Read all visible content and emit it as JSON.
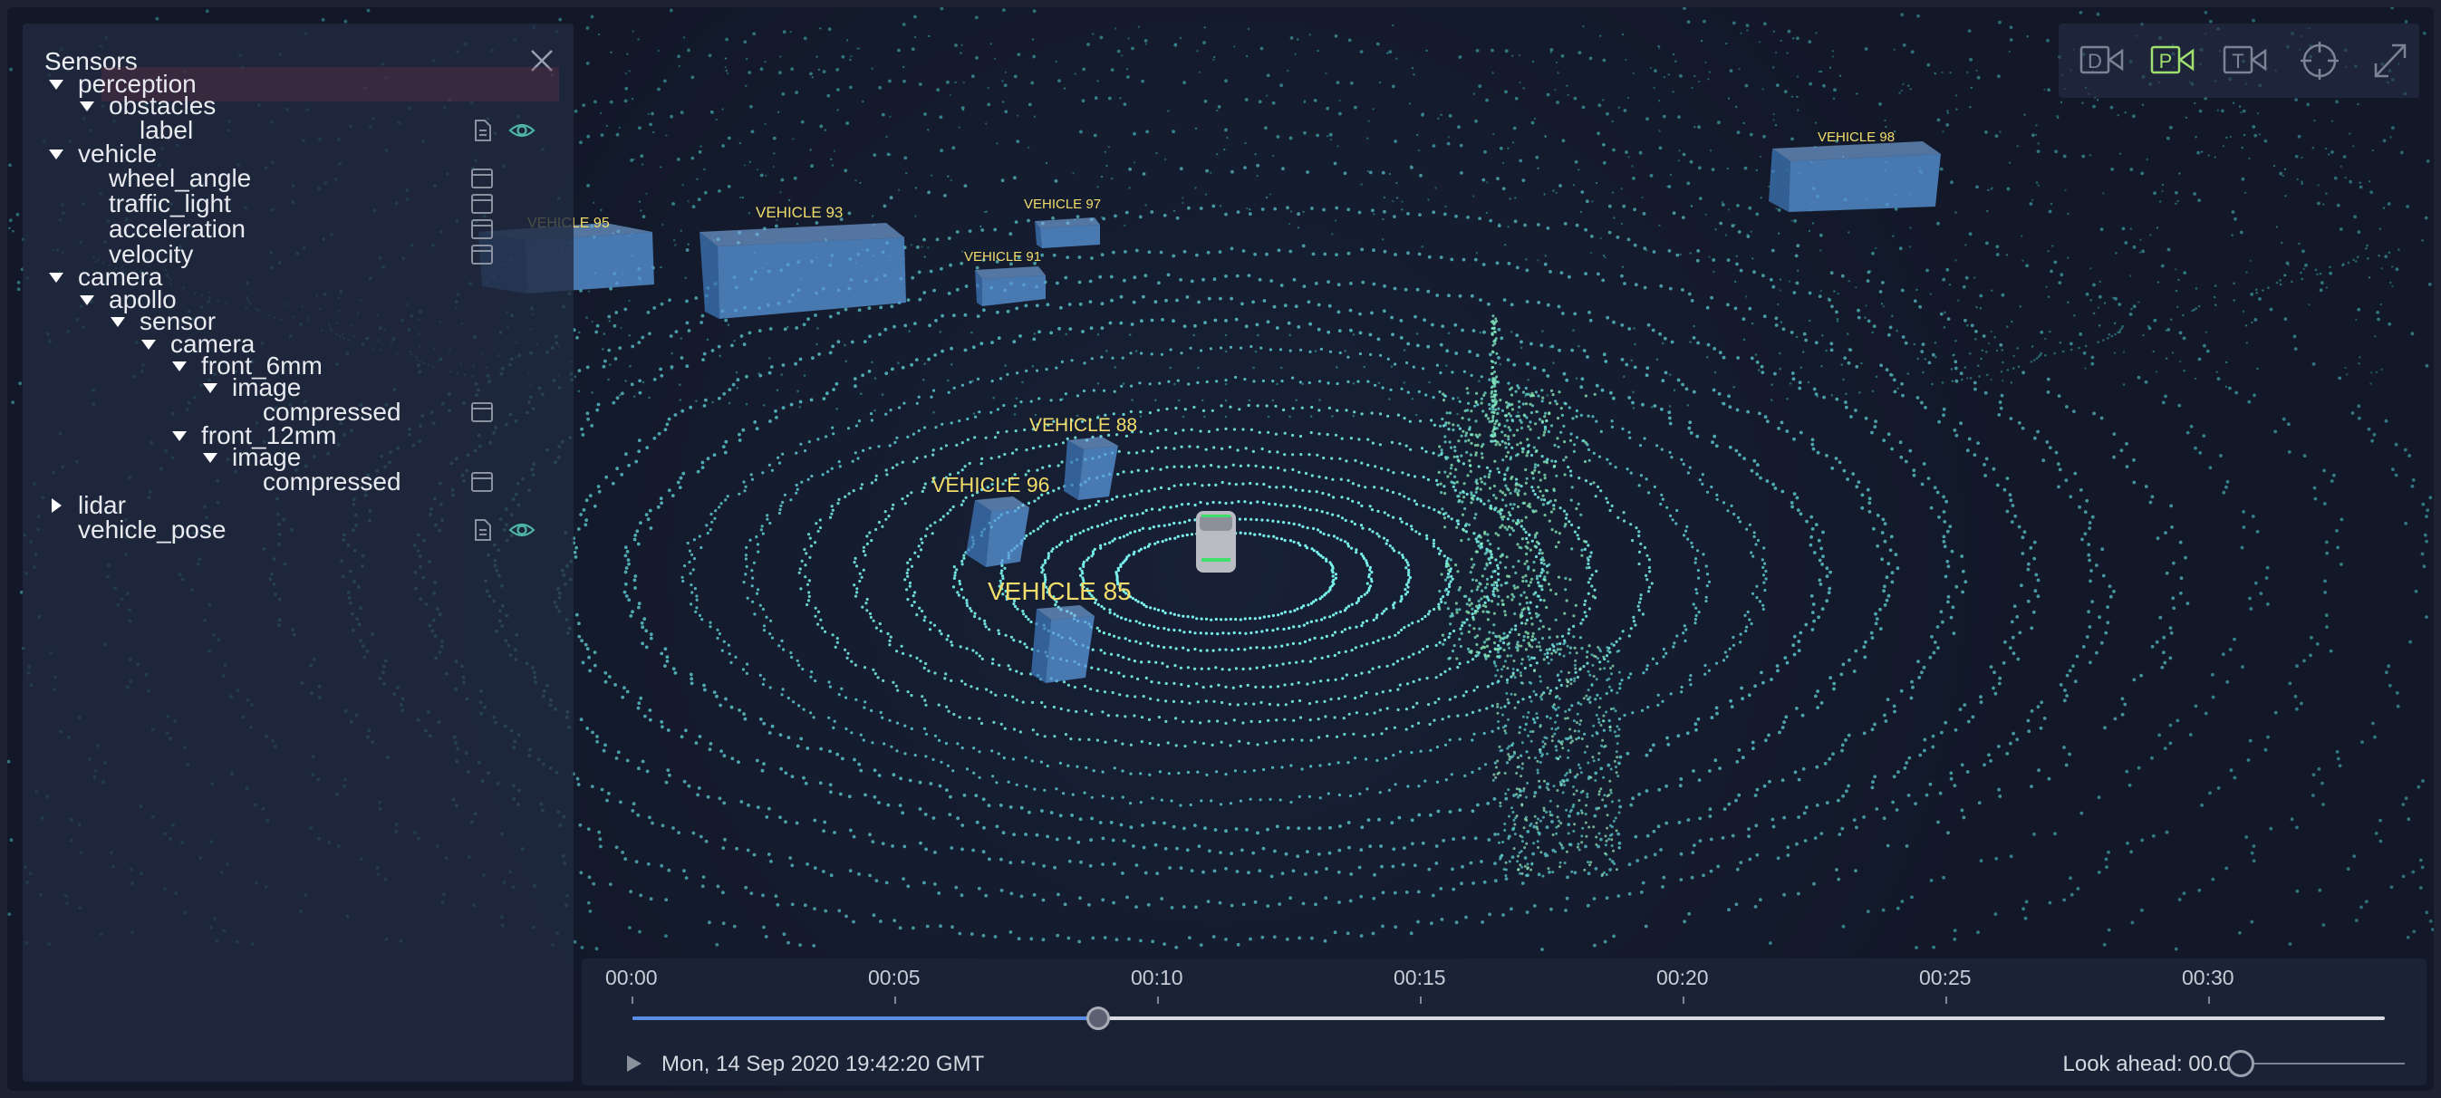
{
  "colors": {
    "accent": "#5a8de6",
    "vehicle_label": "#f2dd6b",
    "point_cloud": "#6ff0e0",
    "box_fill": "#4f8fd0"
  },
  "sensors_panel": {
    "title": "Sensors",
    "tree": [
      {
        "label": "perception",
        "depth": 0,
        "arrow": "down",
        "selected": true
      },
      {
        "label": "obstacles",
        "depth": 1,
        "arrow": "down"
      },
      {
        "label": "label",
        "depth": 2,
        "arrow": "none",
        "icons": [
          "document-icon",
          "eye-icon"
        ]
      },
      {
        "label": "vehicle",
        "depth": 0,
        "arrow": "down"
      },
      {
        "label": "wheel_angle",
        "depth": 1,
        "arrow": "none",
        "icons": [
          "panel-icon"
        ]
      },
      {
        "label": "traffic_light",
        "depth": 1,
        "arrow": "none",
        "icons": [
          "panel-icon"
        ]
      },
      {
        "label": "acceleration",
        "depth": 1,
        "arrow": "none",
        "icons": [
          "panel-icon"
        ]
      },
      {
        "label": "velocity",
        "depth": 1,
        "arrow": "none",
        "icons": [
          "panel-icon"
        ]
      },
      {
        "label": "camera",
        "depth": 0,
        "arrow": "down"
      },
      {
        "label": "apollo",
        "depth": 1,
        "arrow": "down"
      },
      {
        "label": "sensor",
        "depth": 2,
        "arrow": "down"
      },
      {
        "label": "camera",
        "depth": 3,
        "arrow": "down"
      },
      {
        "label": "front_6mm",
        "depth": 4,
        "arrow": "down"
      },
      {
        "label": "image",
        "depth": 5,
        "arrow": "down"
      },
      {
        "label": "compressed",
        "depth": 6,
        "arrow": "none",
        "icons": [
          "panel-icon"
        ]
      },
      {
        "label": "front_12mm",
        "depth": 4,
        "arrow": "down"
      },
      {
        "label": "image",
        "depth": 5,
        "arrow": "down"
      },
      {
        "label": "compressed",
        "depth": 6,
        "arrow": "none",
        "icons": [
          "panel-icon"
        ]
      },
      {
        "label": "lidar",
        "depth": 0,
        "arrow": "right"
      },
      {
        "label": "vehicle_pose",
        "depth": 0,
        "arrow": "none",
        "icons": [
          "document-icon",
          "eye-icon"
        ]
      }
    ]
  },
  "toolbar": {
    "buttons": [
      {
        "letter": "D",
        "name": "driver-camera-button",
        "active": false
      },
      {
        "letter": "P",
        "name": "perspective-camera-button",
        "active": true
      },
      {
        "letter": "T",
        "name": "top-camera-button",
        "active": false
      }
    ]
  },
  "scene": {
    "vehicles": [
      {
        "label": "VEHICLE 95"
      },
      {
        "label": "VEHICLE 93"
      },
      {
        "label": "VEHICLE 97"
      },
      {
        "label": "VEHICLE 91"
      },
      {
        "label": "VEHICLE 98"
      },
      {
        "label": "VEHICLE 88"
      },
      {
        "label": "VEHICLE 96"
      },
      {
        "label": "VEHICLE 85"
      }
    ]
  },
  "timeline": {
    "ticks": [
      "00:00",
      "00:05",
      "00:10",
      "00:15",
      "00:20",
      "00:25",
      "00:30"
    ],
    "progress_fraction": 0.266,
    "timestamp": "Mon, 14 Sep 2020 19:42:20 GMT",
    "look_ahead_label": "Look ahead: 00.0",
    "look_ahead_value": 0
  }
}
